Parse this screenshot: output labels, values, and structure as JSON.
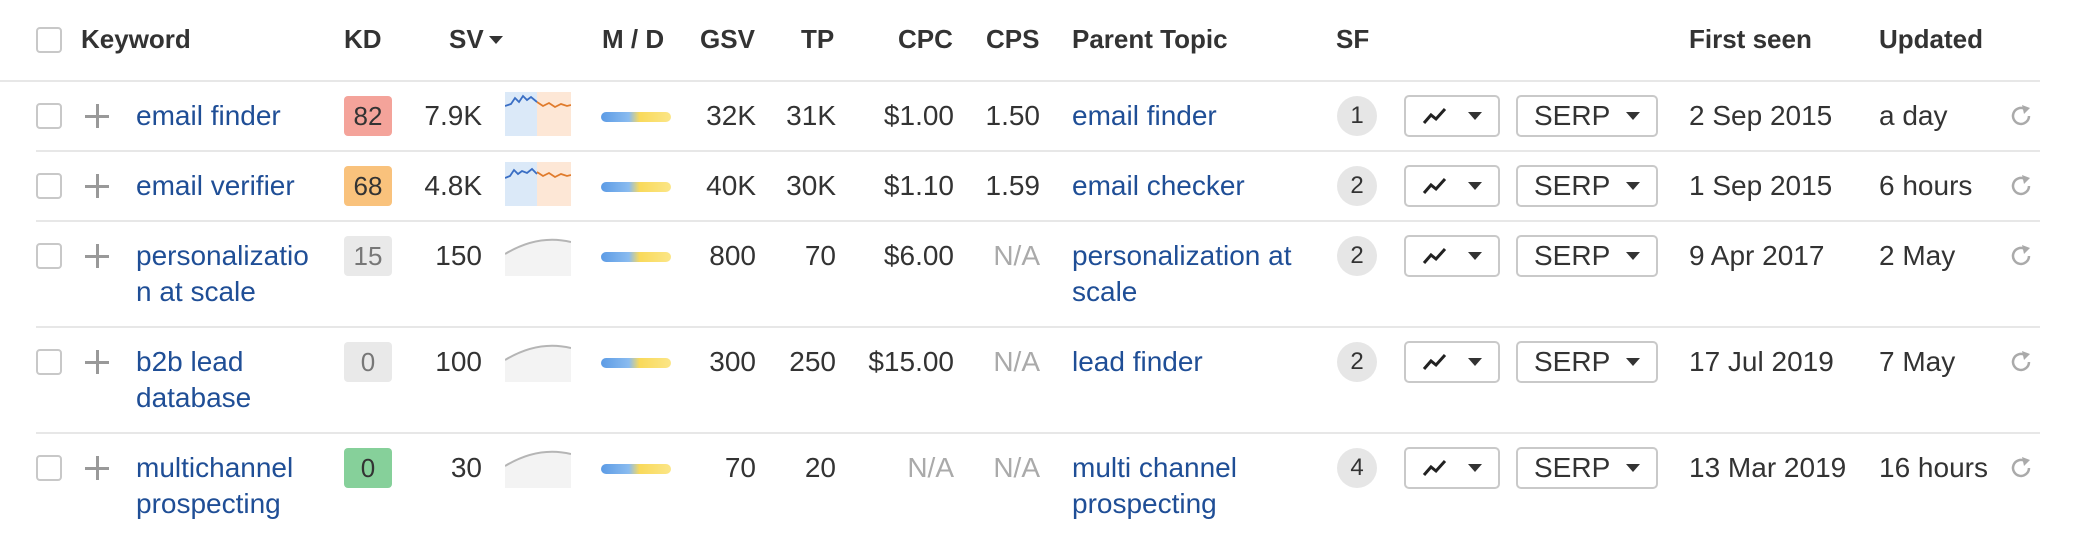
{
  "columns": {
    "keyword": "Keyword",
    "kd": "KD",
    "sv": "SV",
    "md": "M / D",
    "gsv": "GSV",
    "tp": "TP",
    "cpc": "CPC",
    "cps": "CPS",
    "parent": "Parent Topic",
    "sf": "SF",
    "first_seen": "First seen",
    "updated": "Updated"
  },
  "serp_label": "SERP",
  "rows": [
    {
      "keyword_lines": [
        "email finder",
        ""
      ],
      "kd": "82",
      "kd_color": "#f4a39a",
      "sv": "7.9K",
      "gsv": "32K",
      "tp": "31K",
      "cpc": "$1.00",
      "cps": "1.50",
      "parent_lines": [
        "email finder",
        ""
      ],
      "sf": "1",
      "first_seen": "2 Sep 2015",
      "updated": "a day"
    },
    {
      "keyword_lines": [
        "email verifier",
        ""
      ],
      "kd": "68",
      "kd_color": "#f9c27c",
      "sv": "4.8K",
      "gsv": "40K",
      "tp": "30K",
      "cpc": "$1.10",
      "cps": "1.59",
      "parent_lines": [
        "email checker",
        ""
      ],
      "sf": "2",
      "first_seen": "1 Sep 2015",
      "updated": "6 hours"
    },
    {
      "keyword_lines": [
        "personalizatio",
        "n at scale"
      ],
      "kd": "15",
      "kd_color": "#e9e9e9",
      "sv": "150",
      "gsv": "800",
      "tp": "70",
      "cpc": "$6.00",
      "cps": "N/A",
      "parent_lines": [
        "personalization at",
        "scale"
      ],
      "sf": "2",
      "first_seen": "9 Apr 2017",
      "updated": "2 May"
    },
    {
      "keyword_lines": [
        "b2b lead",
        "database"
      ],
      "kd": "0",
      "kd_color": "#e9e9e9",
      "sv": "100",
      "gsv": "300",
      "tp": "250",
      "cpc": "$15.00",
      "cps": "N/A",
      "parent_lines": [
        "lead finder",
        ""
      ],
      "sf": "2",
      "first_seen": "17 Jul 2019",
      "updated": "7 May"
    },
    {
      "keyword_lines": [
        "multichannel",
        "prospecting"
      ],
      "kd": "0",
      "kd_color": "#86d09a",
      "sv": "30",
      "gsv": "70",
      "tp": "20",
      "cpc": "N/A",
      "cps": "N/A",
      "parent_lines": [
        "multi channel",
        "prospecting"
      ],
      "sf": "4",
      "first_seen": "13 Mar 2019",
      "updated": "16 hours"
    }
  ]
}
